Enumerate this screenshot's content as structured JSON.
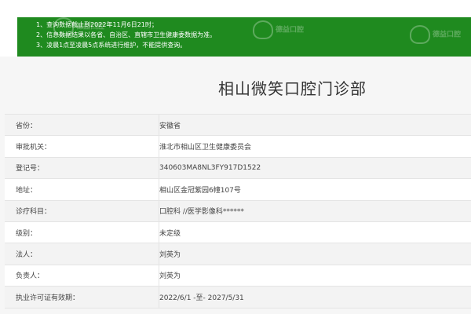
{
  "notice": {
    "lines": [
      "1、查询数据截止到2022年11月6日21时；",
      "2、信息数据结果以各省、自治区、直辖市卫生健康委数据为准。",
      "3、凌晨1点至凌晨5点系统进行维护，不能提供查询。"
    ],
    "watermark": "德益口腔"
  },
  "title": "相山微笑口腔门诊部",
  "rows": [
    {
      "label": "省份：",
      "value": "安徽省"
    },
    {
      "label": "审批机关：",
      "value": "淮北市相山区卫生健康委员会"
    },
    {
      "label": "登记号：",
      "value": "340603MA8NL3FY917D1522"
    },
    {
      "label": "地址：",
      "value": "相山区金冠紫园6幢107号"
    },
    {
      "label": "诊疗科目：",
      "value": "口腔科 //医学影像科******"
    },
    {
      "label": "级别：",
      "value": "未定级"
    },
    {
      "label": "法人：",
      "value": "刘英为"
    },
    {
      "label": "负责人：",
      "value": "刘英为"
    },
    {
      "label": "执业许可证有效期：",
      "value": "2022/6/1 -至- 2027/5/31"
    }
  ]
}
